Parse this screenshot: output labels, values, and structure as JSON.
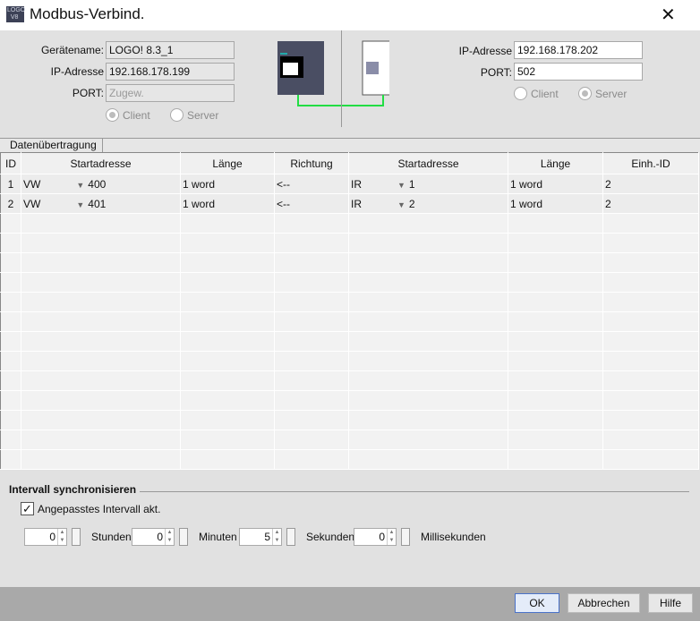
{
  "window": {
    "title": "Modbus-Verbind.",
    "logo_text": "LOGO V8"
  },
  "local": {
    "device_label": "Gerätename:",
    "device_value": "LOGO! 8.3_1",
    "ip_label": "IP-Adresse",
    "ip_value": "192.168.178.199",
    "port_label": "PORT:",
    "port_placeholder": "Zugew.",
    "client_label": "Client",
    "server_label": "Server",
    "selected": "Client"
  },
  "remote": {
    "ip_label": "IP-Adresse",
    "ip_value": "192.168.178.202",
    "port_label": "PORT:",
    "port_value": "502",
    "client_label": "Client",
    "server_label": "Server",
    "selected": "Server"
  },
  "connection_color": "#22dd44",
  "section": {
    "title": "Datenübertragung"
  },
  "table": {
    "headers": [
      "ID",
      "Startadresse",
      "Länge",
      "Richtung",
      "Startadresse",
      "Länge",
      "Einh.-ID"
    ],
    "rows": [
      {
        "id": "1",
        "local_type": "VW",
        "local_addr": "400",
        "local_len": "1 word",
        "dir": "<--",
        "remote_type": "IR",
        "remote_addr": "1",
        "remote_len": "1 word",
        "unit_id": "2"
      },
      {
        "id": "2",
        "local_type": "VW",
        "local_addr": "401",
        "local_len": "1 word",
        "dir": "<--",
        "remote_type": "IR",
        "remote_addr": "2",
        "remote_len": "1 word",
        "unit_id": "2"
      }
    ]
  },
  "interval": {
    "title": "Intervall synchronisieren",
    "checkbox_label": "Angepasstes Intervall akt.",
    "checked": true,
    "hours": "0",
    "hours_label": "Stunden",
    "minutes": "0",
    "minutes_label": "Minuten",
    "seconds": "5",
    "seconds_label": "Sekunden",
    "ms": "0",
    "ms_label": "Millisekunden"
  },
  "buttons": {
    "ok": "OK",
    "cancel": "Abbrechen",
    "help": "Hilfe"
  }
}
